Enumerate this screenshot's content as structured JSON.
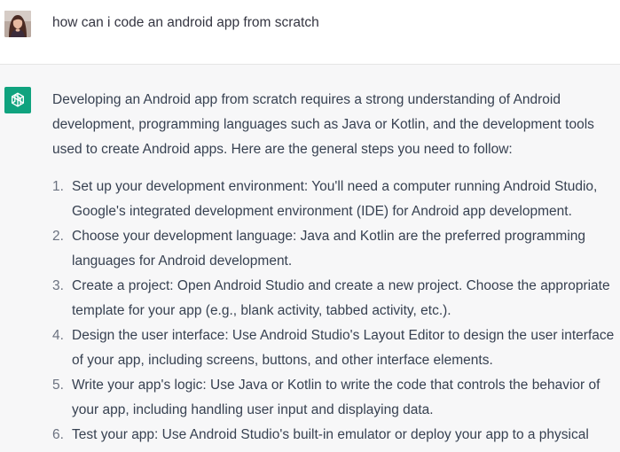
{
  "user_message": {
    "text": "how can i code an android app from scratch"
  },
  "assistant_message": {
    "intro_lines": [
      "Developing an Android app from scratch requires a strong understanding of Android",
      "development, programming languages such as Java or Kotlin, and the development tools",
      "used to create Android apps. Here are the general steps you need to follow:"
    ],
    "steps": [
      {
        "number": "1.",
        "lines": [
          "Set up your development environment: You'll need a computer running Android Studio,",
          "Google's integrated development environment (IDE) for Android app development."
        ]
      },
      {
        "number": "2.",
        "lines": [
          "Choose your development language: Java and Kotlin are the preferred programming",
          "languages for Android development."
        ]
      },
      {
        "number": "3.",
        "lines": [
          "Create a project: Open Android Studio and create a new project. Choose the appropriate",
          "template for your app (e.g., blank activity, tabbed activity, etc.)."
        ]
      },
      {
        "number": "4.",
        "lines": [
          "Design the user interface: Use Android Studio's Layout Editor to design the user interface",
          "of your app, including screens, buttons, and other interface elements."
        ]
      },
      {
        "number": "5.",
        "lines": [
          "Write your app's logic: Use Java or Kotlin to write the code that controls the behavior of",
          "your app, including handling user input and displaying data."
        ]
      },
      {
        "number": "6.",
        "lines": [
          "Test your app: Use Android Studio's built-in emulator or deploy your app to a physical"
        ]
      }
    ]
  },
  "colors": {
    "assistant_bg": "#f7f7f8",
    "bot_avatar": "#10a37f",
    "text": "#374151"
  },
  "icons": {
    "user_avatar": "user-avatar-photo",
    "bot_avatar": "openai-logo-icon"
  }
}
